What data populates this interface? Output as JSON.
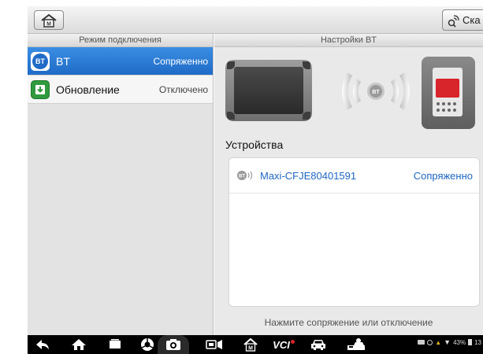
{
  "toolbar": {
    "home_icon": "home-icon",
    "scan_label": "Ска",
    "scan_icon": "bluetooth-scan-icon"
  },
  "left_panel": {
    "header": "Режим подключения",
    "items": [
      {
        "icon": "bt-icon",
        "icon_text": "BT",
        "label": "BT",
        "status": "Сопряженно",
        "selected": true
      },
      {
        "icon": "update-icon",
        "label": "Обновление",
        "status": "Отключено",
        "selected": false
      }
    ]
  },
  "right_panel": {
    "header": "Настройки BT",
    "illustration": {
      "bt_badge": "BT"
    },
    "devices_title": "Устройства",
    "devices": [
      {
        "name": "Maxi-CFJE80401591",
        "status": "Сопряженно"
      }
    ],
    "hint": "Нажмите сопряжение или отключение"
  },
  "navbar": {
    "icons": [
      "back-icon",
      "home-icon",
      "recent-apps-icon",
      "browser-icon",
      "camera-icon",
      "screen-record-icon",
      "maxi-home-icon",
      "vci-icon",
      "car-icon",
      "multi-car-icon"
    ],
    "vci_label": "VCI",
    "status": {
      "battery": "43%",
      "time": "13"
    }
  },
  "colors": {
    "selected_blue": "#1f6bc7",
    "link_blue": "#1f66c2",
    "update_green": "#2f9a3e"
  }
}
